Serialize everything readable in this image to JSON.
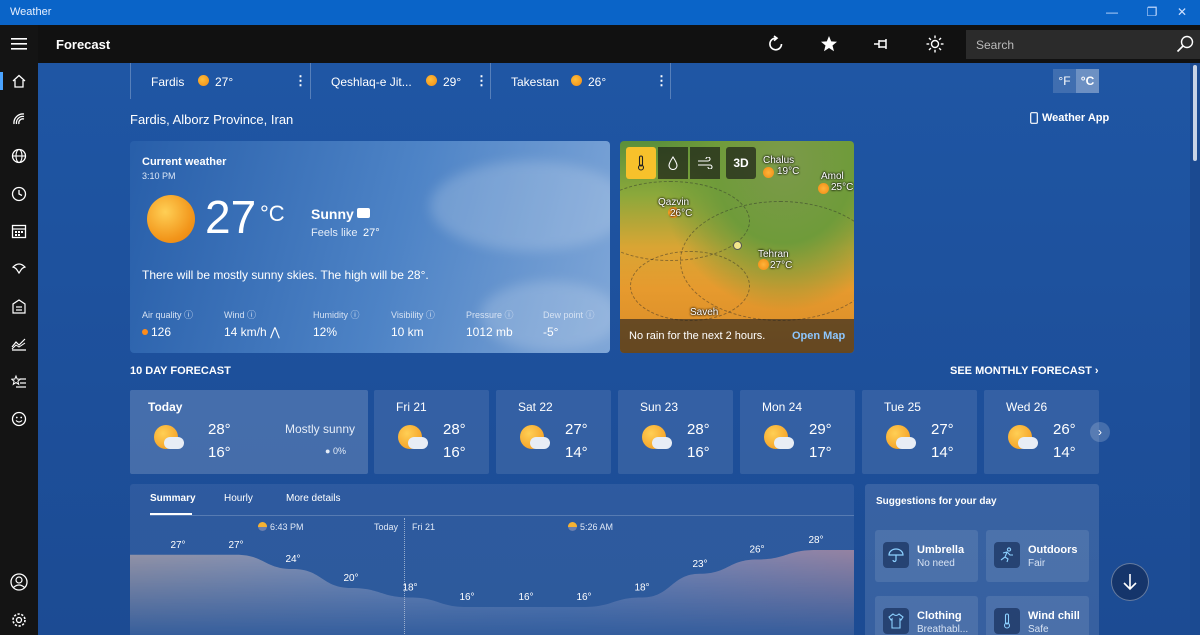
{
  "app": {
    "title": "Weather"
  },
  "topbar": {
    "title": "Forecast",
    "search_placeholder": "Search"
  },
  "locations": [
    {
      "name": "Fardis",
      "temp": "27°"
    },
    {
      "name": "Qeshlaq-e Jit...",
      "temp": "29°"
    },
    {
      "name": "Takestan",
      "temp": "26°"
    }
  ],
  "units": {
    "f": "°F",
    "c": "°C",
    "selected": "c"
  },
  "place": "Fardis, Alborz Province, Iran",
  "weather_app_link": "Weather App",
  "current": {
    "label": "Current weather",
    "time": "3:10 PM",
    "temp": "27",
    "unit": "°C",
    "condition": "Sunny",
    "feels_label": "Feels like",
    "feels_value": "27°",
    "summary": "There will be mostly sunny skies. The high will be 28°.",
    "metrics": [
      {
        "label": "Air quality",
        "value": "126"
      },
      {
        "label": "Wind",
        "value": "14 km/h"
      },
      {
        "label": "Humidity",
        "value": "12%"
      },
      {
        "label": "Visibility",
        "value": "10 km"
      },
      {
        "label": "Pressure",
        "value": "1012 mb"
      },
      {
        "label": "Dew point",
        "value": "-5°"
      }
    ]
  },
  "map": {
    "tools": [
      "temperature-icon",
      "drop-icon",
      "wind-icon",
      "3D"
    ],
    "cities": [
      {
        "name": "Chalus",
        "temp": "19°C"
      },
      {
        "name": "Amol",
        "temp": "25°C"
      },
      {
        "name": "Qazvin",
        "temp": "26°C"
      },
      {
        "name": "Tehran",
        "temp": "27°C"
      },
      {
        "name": "Saveh",
        "temp": ""
      }
    ],
    "rain_note": "No rain for the next 2 hours.",
    "open_map": "Open Map"
  },
  "forecast": {
    "title": "10 DAY FORECAST",
    "see_monthly": "SEE MONTHLY FORECAST",
    "days": [
      {
        "name": "Today",
        "hi": "28°",
        "lo": "16°",
        "desc": "Mostly sunny",
        "precip": "0%"
      },
      {
        "name": "Fri 21",
        "hi": "28°",
        "lo": "16°"
      },
      {
        "name": "Sat 22",
        "hi": "27°",
        "lo": "14°"
      },
      {
        "name": "Sun 23",
        "hi": "28°",
        "lo": "16°"
      },
      {
        "name": "Mon 24",
        "hi": "29°",
        "lo": "17°"
      },
      {
        "name": "Tue 25",
        "hi": "27°",
        "lo": "14°"
      },
      {
        "name": "Wed 26",
        "hi": "26°",
        "lo": "14°"
      }
    ]
  },
  "detail": {
    "tabs": [
      "Summary",
      "Hourly",
      "More details"
    ],
    "sunset": "6:43 PM",
    "today": "Today",
    "next_day": "Fri 21",
    "sunrise": "5:26 AM",
    "hourly_temps": [
      "27°",
      "27°",
      "24°",
      "20°",
      "18°",
      "16°",
      "16°",
      "16°",
      "18°",
      "23°",
      "26°",
      "28°"
    ]
  },
  "suggestions": {
    "title": "Suggestions for your day",
    "items": [
      {
        "title": "Umbrella",
        "value": "No need",
        "icon": "umbrella-icon"
      },
      {
        "title": "Outdoors",
        "value": "Fair",
        "icon": "running-icon"
      },
      {
        "title": "Clothing",
        "value": "Breathabl...",
        "icon": "shirt-icon"
      },
      {
        "title": "Wind chill",
        "value": "Safe",
        "icon": "thermometer-icon"
      }
    ]
  },
  "colors": {
    "accent": "#0a64c8",
    "link": "#8dc7ff",
    "aq_dot": "#ff8c1a"
  }
}
